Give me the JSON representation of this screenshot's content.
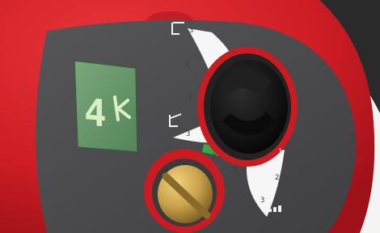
{
  "display": {
    "readout": "4"
  },
  "dial_upper": {
    "numbers": [
      "3",
      "2",
      "1"
    ]
  },
  "dial_lower": {
    "numbers": [
      "3",
      "2",
      "1"
    ]
  },
  "dial_right": {
    "numbers": [
      "1",
      "2",
      "3"
    ]
  },
  "colors": {
    "housing_red": "#d21f26",
    "panel_gray": "#4b4b4d",
    "lcd_green": "#6a9a6c",
    "indicator_green": "#39a647",
    "knob_black": "#141414",
    "brass": "#c9a24b"
  },
  "icons": [
    "constant-curve-icon",
    "proportional-curve-icon",
    "bar-steps-icon"
  ]
}
